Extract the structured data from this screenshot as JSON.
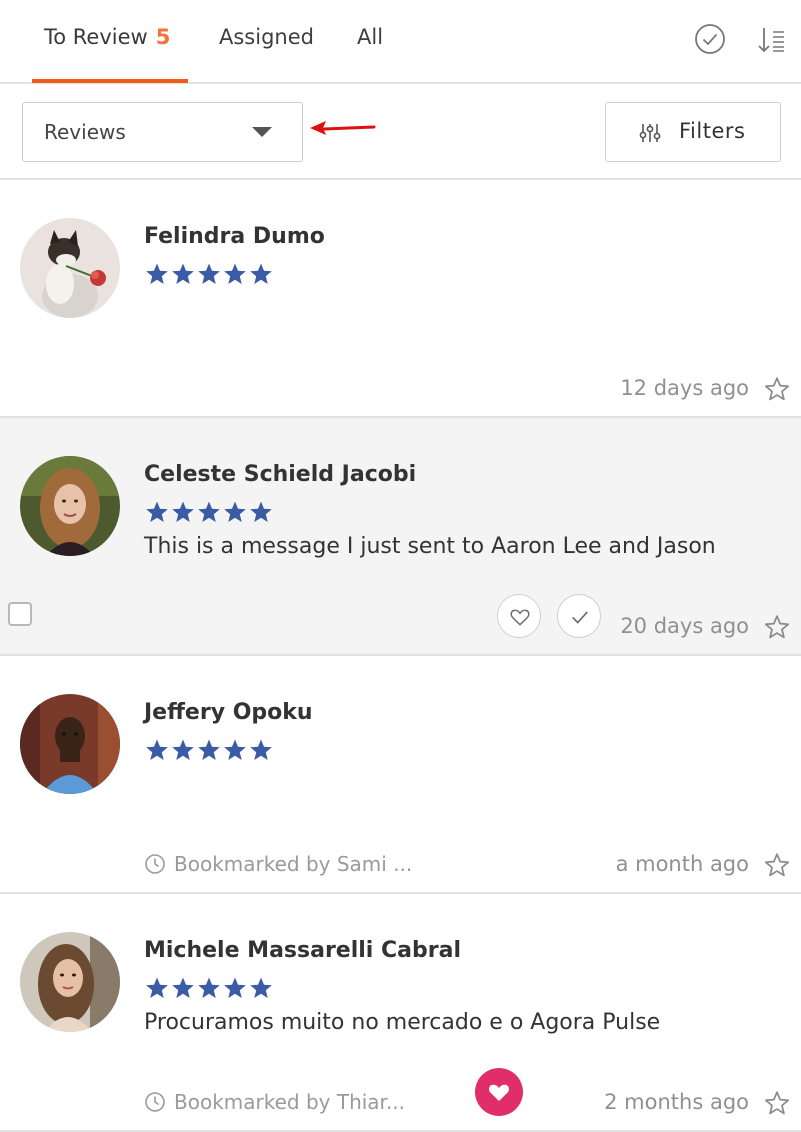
{
  "tabs": [
    {
      "label": "To Review",
      "count": "5"
    },
    {
      "label": "Assigned"
    },
    {
      "label": "All"
    }
  ],
  "toolbar": {
    "type_select_value": "Reviews",
    "filters_label": "Filters"
  },
  "reviews": [
    {
      "name": "Felindra Dumo",
      "rating": 5,
      "message": "",
      "time": "12 days ago",
      "bookmark": ""
    },
    {
      "name": "Celeste Schield Jacobi",
      "rating": 5,
      "message": "This is a message I just sent to Aaron Lee and Jason",
      "time": "20 days ago",
      "bookmark": ""
    },
    {
      "name": "Jeffery Opoku",
      "rating": 5,
      "message": "",
      "time": "a month ago",
      "bookmark": "Bookmarked by Sami ..."
    },
    {
      "name": "Michele Massarelli Cabral",
      "rating": 5,
      "message": "Procuramos muito no mercado e o Agora Pulse",
      "time": "2 months ago",
      "bookmark": "Bookmarked by Thiar..."
    }
  ],
  "colors": {
    "accent": "#f05a1a",
    "count": "#f4733a",
    "star": "#3b5ba5",
    "love": "#e02e6a",
    "annotation_arrow": "#e01010"
  },
  "icons": {
    "mark_all_reviewed": "check-circle-icon",
    "sort": "sort-icon",
    "filters": "sliders-icon",
    "favorite": "star-outline-icon",
    "bookmark": "clock-icon",
    "like": "heart-icon",
    "reviewed": "check-icon"
  }
}
